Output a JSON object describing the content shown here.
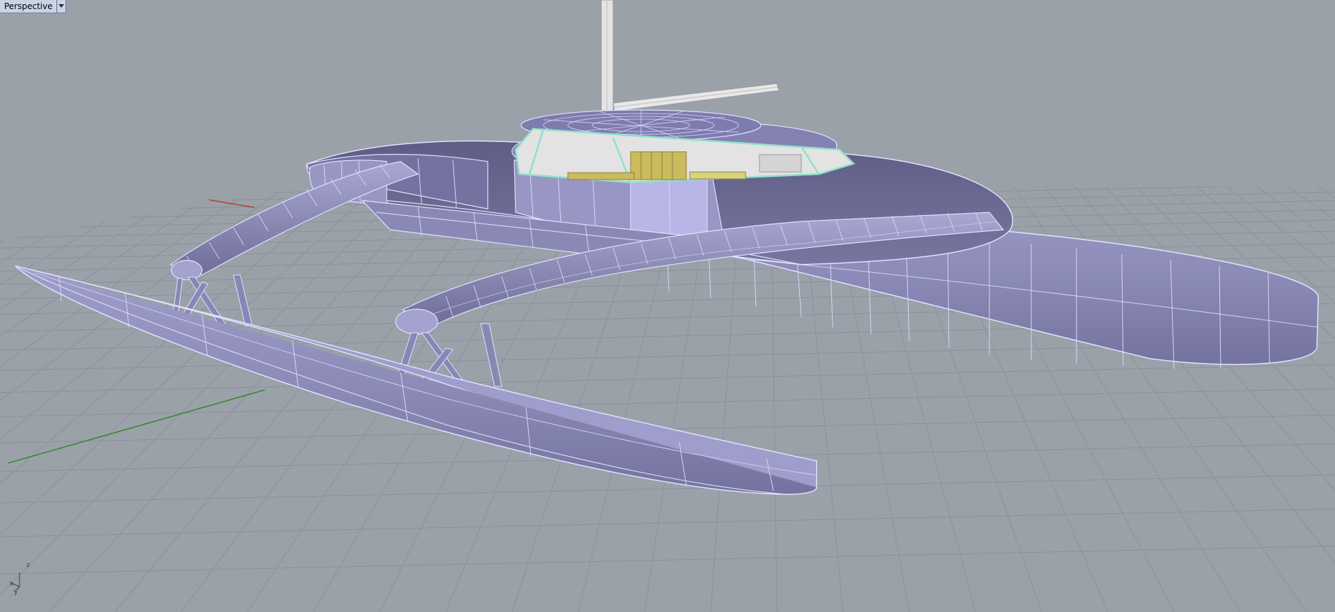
{
  "viewport": {
    "title": "Perspective",
    "menu_icon": "dropdown-triangle-icon"
  },
  "axis_icon": {
    "name": "world-axes-icon",
    "z_label": "z",
    "x_label": "x",
    "y_label": "y"
  },
  "colors": {
    "background": "#9aa1a9",
    "grid": "#8a9098",
    "hull_fill": "#8d8cb8",
    "hull_edge": "#e2e1ff",
    "glass": "#8fe0c9",
    "interior": "#c9bb5e",
    "x_axis": "#b3412f",
    "y_axis": "#2f8a2c"
  }
}
